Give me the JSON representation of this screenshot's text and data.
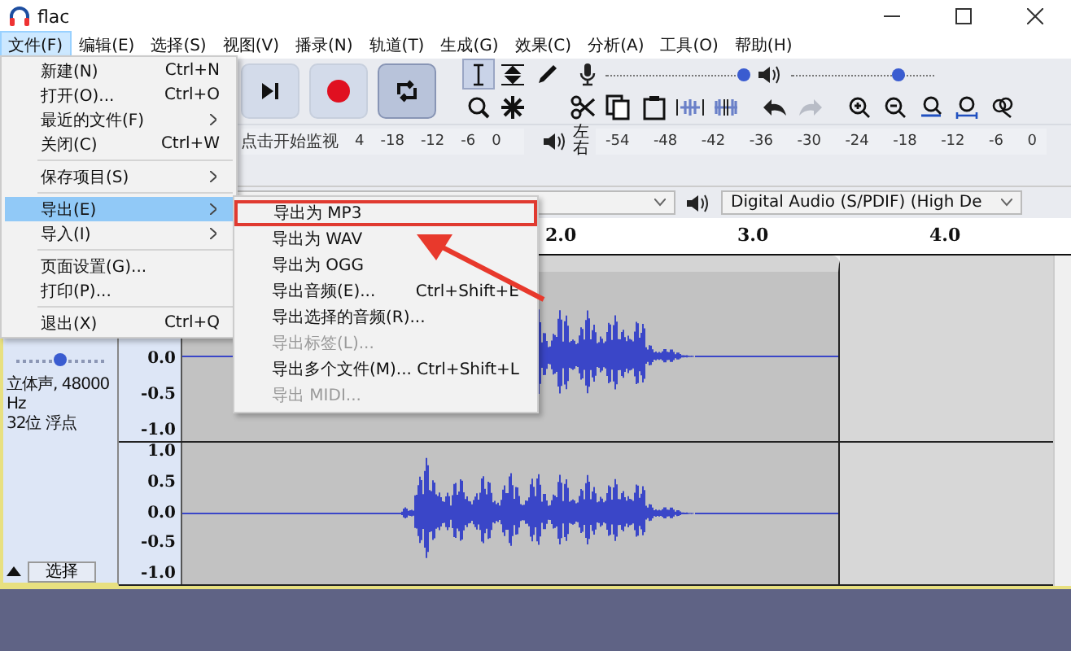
{
  "window": {
    "title": "flac"
  },
  "menu_bar": [
    {
      "label": "文件(F)",
      "selected": true
    },
    {
      "label": "编辑(E)",
      "selected": false
    },
    {
      "label": "选择(S)",
      "selected": false
    },
    {
      "label": "视图(V)",
      "selected": false
    },
    {
      "label": "播录(N)",
      "selected": false
    },
    {
      "label": "轨道(T)",
      "selected": false
    },
    {
      "label": "生成(G)",
      "selected": false
    },
    {
      "label": "效果(C)",
      "selected": false
    },
    {
      "label": "分析(A)",
      "selected": false
    },
    {
      "label": "工具(O)",
      "selected": false
    },
    {
      "label": "帮助(H)",
      "selected": false
    }
  ],
  "input_slider": {
    "level": 0.97
  },
  "output_slider": {
    "level": 0.75
  },
  "recording_meter": {
    "hint": "点击开始监视",
    "ticks": [
      "4",
      "-18",
      "-12",
      "-6",
      "0"
    ]
  },
  "playback_meter": {
    "channel_labels": [
      "左",
      "右"
    ],
    "ticks": [
      "-54",
      "-48",
      "-42",
      "-36",
      "-30",
      "-24",
      "-18",
      "-12",
      "-6",
      "0"
    ]
  },
  "device_bar": {
    "playback_device": "Digital Audio (S/PDIF) (High De"
  },
  "ruler": {
    "labels": [
      "2.0",
      "3.0",
      "4.0"
    ]
  },
  "track": {
    "pan_slider": {
      "level": 0.5
    },
    "info": [
      "立体声, 48000 Hz",
      "32位 浮点"
    ],
    "select_button": "选择",
    "channels": [
      {
        "scale": [
          "0.0",
          "-0.5",
          "-1.0"
        ]
      },
      {
        "scale": [
          "1.0",
          "0.5",
          "0.0",
          "-0.5",
          "-1.0"
        ]
      }
    ]
  },
  "file_menu": {
    "items": [
      {
        "kind": "item",
        "label": "新建(N)",
        "shortcut": "Ctrl+N",
        "submenu": false,
        "selected": false
      },
      {
        "kind": "item",
        "label": "打开(O)...",
        "shortcut": "Ctrl+O",
        "submenu": false,
        "selected": false
      },
      {
        "kind": "item",
        "label": "最近的文件(F)",
        "submenu": true,
        "selected": false
      },
      {
        "kind": "item",
        "label": "关闭(C)",
        "shortcut": "Ctrl+W",
        "submenu": false,
        "selected": false
      },
      {
        "kind": "separator"
      },
      {
        "kind": "item",
        "label": "保存项目(S)",
        "submenu": true,
        "selected": false
      },
      {
        "kind": "separator"
      },
      {
        "kind": "item",
        "label": "导出(E)",
        "submenu": true,
        "selected": true
      },
      {
        "kind": "item",
        "label": "导入(I)",
        "submenu": true,
        "selected": false
      },
      {
        "kind": "separator"
      },
      {
        "kind": "item",
        "label": "页面设置(G)...",
        "submenu": false,
        "selected": false
      },
      {
        "kind": "item",
        "label": "打印(P)...",
        "submenu": false,
        "selected": false
      },
      {
        "kind": "separator"
      },
      {
        "kind": "item",
        "label": "退出(X)",
        "shortcut": "Ctrl+Q",
        "submenu": false,
        "selected": false
      }
    ]
  },
  "export_submenu": {
    "items": [
      {
        "label": "导出为 MP3",
        "disabled": false,
        "highlighted": true
      },
      {
        "label": "导出为 WAV",
        "disabled": false,
        "highlighted": false
      },
      {
        "label": "导出为 OGG",
        "disabled": false,
        "highlighted": false
      },
      {
        "label": "导出音频(E)...",
        "shortcut": "Ctrl+Shift+E",
        "disabled": false,
        "highlighted": false
      },
      {
        "label": "导出选择的音频(R)...",
        "disabled": false,
        "highlighted": false
      },
      {
        "label": "导出标签(L)...",
        "disabled": true,
        "highlighted": false
      },
      {
        "label": "导出多个文件(M)...",
        "shortcut": "Ctrl+Shift+L",
        "disabled": false,
        "highlighted": false
      },
      {
        "label": "导出 MIDI...",
        "disabled": true,
        "highlighted": false
      }
    ]
  }
}
